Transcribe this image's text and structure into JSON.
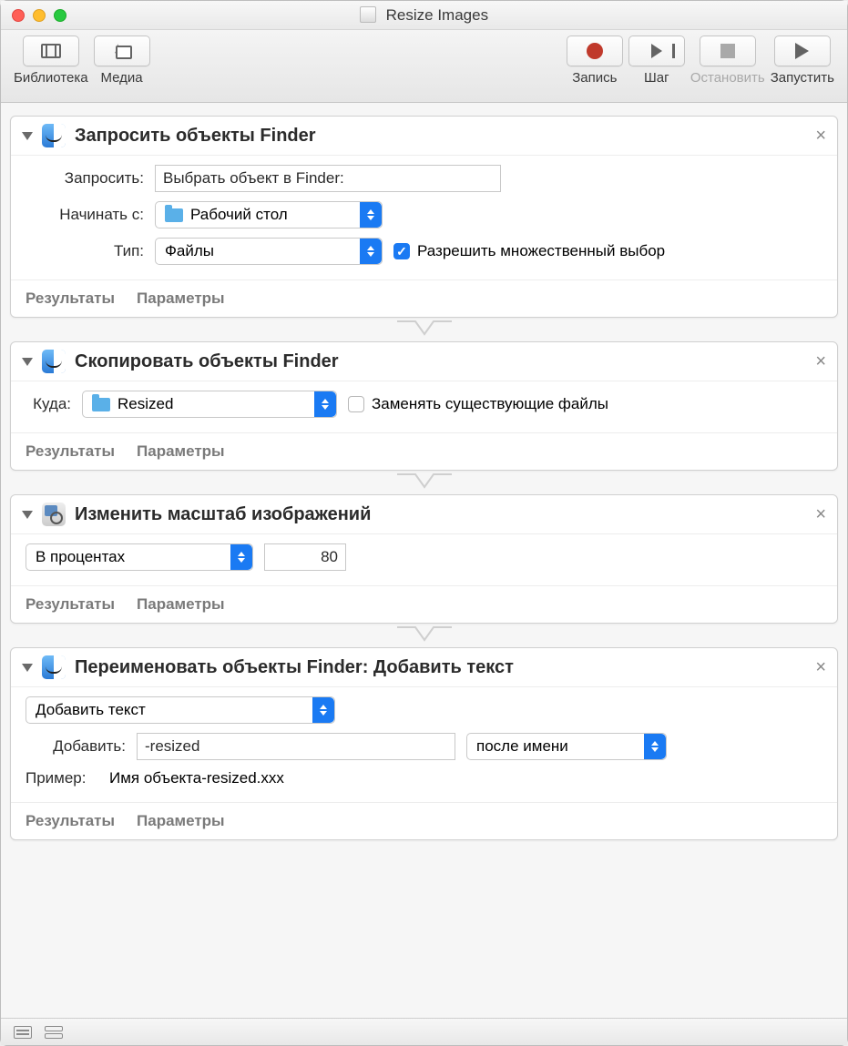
{
  "window": {
    "title": "Resize Images"
  },
  "toolbar": {
    "library": "Библиотека",
    "media": "Медиа",
    "record": "Запись",
    "step": "Шаг",
    "stop": "Остановить",
    "run": "Запустить"
  },
  "footer": {
    "results": "Результаты",
    "options": "Параметры"
  },
  "actions": {
    "ask": {
      "title": "Запросить объекты Finder",
      "prompt_label": "Запросить:",
      "prompt_value": "Выбрать объект в Finder:",
      "start_label": "Начинать с:",
      "start_value": "Рабочий стол",
      "type_label": "Тип:",
      "type_value": "Файлы",
      "allow_multi": "Разрешить множественный выбор"
    },
    "copy": {
      "title": "Скопировать объекты Finder",
      "to_label": "Куда:",
      "to_value": "Resized",
      "replace": "Заменять существующие файлы"
    },
    "scale": {
      "title": "Изменить масштаб изображений",
      "mode": "В процентах",
      "value": "80"
    },
    "rename": {
      "title": "Переименовать объекты Finder: Добавить текст",
      "mode": "Добавить текст",
      "add_label": "Добавить:",
      "add_value": "-resized",
      "position": "после имени",
      "example_label": "Пример:",
      "example_value": "Имя объекта-resized.xxx"
    }
  }
}
